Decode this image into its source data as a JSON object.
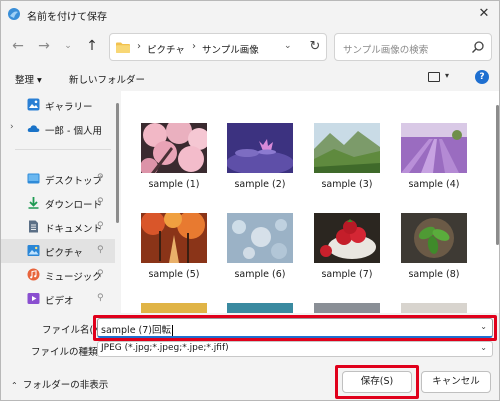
{
  "window": {
    "title": "名前を付けて保存",
    "close_glyph": "✕"
  },
  "nav": {
    "back_glyph": "←",
    "forward_glyph": "→",
    "recent_glyph": "⌄",
    "up_glyph": "↑",
    "breadcrumb": [
      "ピクチャ",
      "サンプル画像"
    ],
    "breadcrumb_sep": "›",
    "address_dropdown_glyph": "⌄",
    "refresh_glyph": "↻",
    "search_placeholder": "サンプル画像の検索"
  },
  "commands": {
    "organize": "整理 ▾",
    "new_folder": "新しいフォルダー",
    "view_dropdown_glyph": "▾",
    "help": "?"
  },
  "sidebar": {
    "items": [
      {
        "label": "ギャラリー",
        "icon": "gallery-icon",
        "pinned": false,
        "expandable": false,
        "selected": false
      },
      {
        "label": "一郎 - 個人用",
        "icon": "onedrive-cloud-icon",
        "pinned": false,
        "expandable": true,
        "selected": false
      },
      {
        "label": "デスクトップ",
        "icon": "desktop-icon",
        "pinned": true,
        "expandable": false,
        "selected": false
      },
      {
        "label": "ダウンロード",
        "icon": "download-icon",
        "pinned": true,
        "expandable": false,
        "selected": false
      },
      {
        "label": "ドキュメント",
        "icon": "documents-icon",
        "pinned": true,
        "expandable": false,
        "selected": false
      },
      {
        "label": "ピクチャ",
        "icon": "pictures-icon",
        "pinned": true,
        "expandable": false,
        "selected": true
      },
      {
        "label": "ミュージック",
        "icon": "music-icon",
        "pinned": true,
        "expandable": false,
        "selected": false
      },
      {
        "label": "ビデオ",
        "icon": "videos-icon",
        "pinned": true,
        "expandable": false,
        "selected": false
      }
    ],
    "pin_glyph": "📌",
    "expand_glyph": "›"
  },
  "files": [
    {
      "name": "sample (1)",
      "subject": "cherry-blossoms"
    },
    {
      "name": "sample (2)",
      "subject": "purple-water-lily"
    },
    {
      "name": "sample (3)",
      "subject": "green-mountain-valley"
    },
    {
      "name": "sample (4)",
      "subject": "lavender-field"
    },
    {
      "name": "sample (5)",
      "subject": "autumn-forest-path"
    },
    {
      "name": "sample (6)",
      "subject": "bokeh-lights"
    },
    {
      "name": "sample (7)",
      "subject": "strawberries-bowl"
    },
    {
      "name": "sample (8)",
      "subject": "basil-bowl"
    }
  ],
  "form": {
    "filename_label": "ファイル名(N):",
    "filename_value": "sample (7)回転",
    "filetype_label": "ファイルの種類(T):",
    "filetype_value": "JPEG (*.jpg;*.jpeg;*.jpe;*.jfif)",
    "dropdown_glyph": "⌄",
    "hide_folders": "フォルダーの非表示",
    "hide_folders_glyph": "⌃",
    "save_button": "保存(S)",
    "cancel_button": "キャンセル"
  },
  "colors": {
    "accent": "#1e6fd0",
    "highlight_frame": "#e0001b",
    "selected_item_bg": "#e2e2e2"
  }
}
